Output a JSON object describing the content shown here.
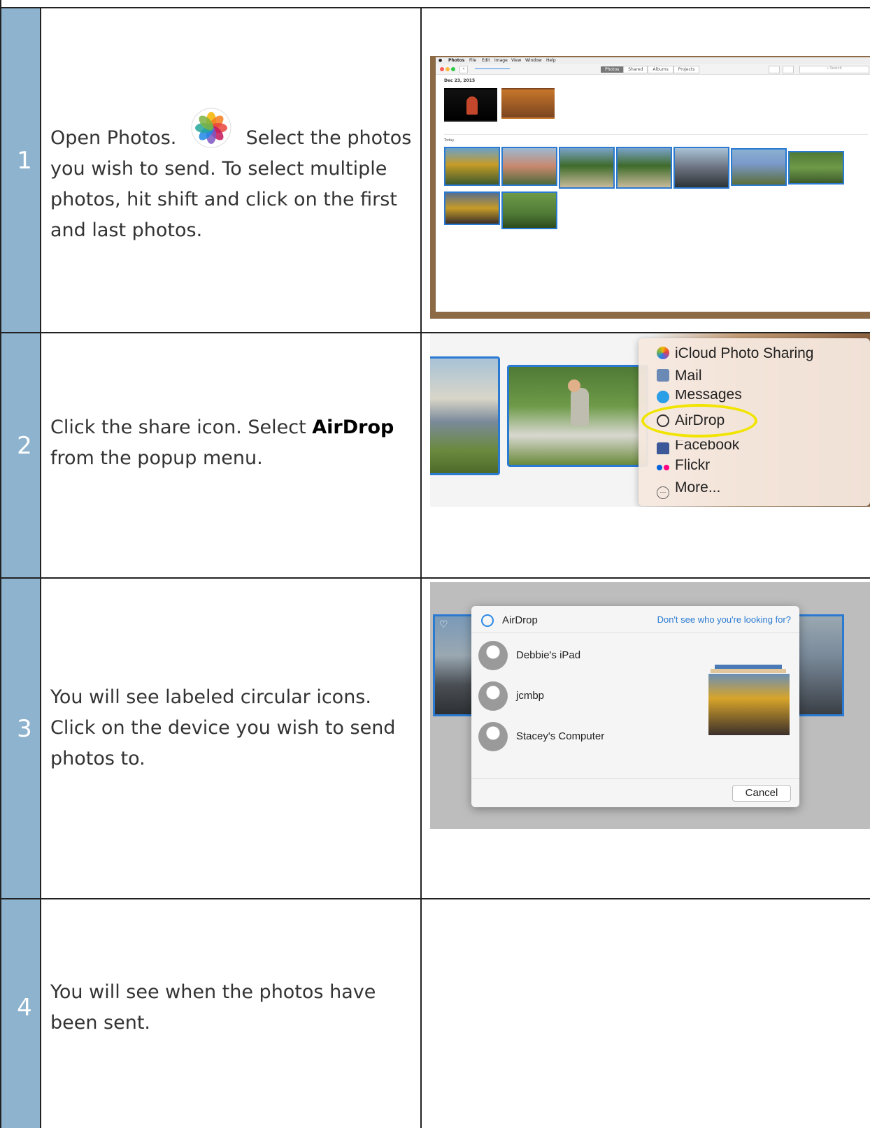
{
  "steps": [
    {
      "number": "1",
      "text_before": "Open Photos.",
      "text_after": "Select the photos you wish to send.  To select multiple photos, hit shift and click on the first and last photos."
    },
    {
      "number": "2",
      "text_before": "Click the share icon.  Select ",
      "highlight": "AirDrop",
      "text_after": " from the popup menu."
    },
    {
      "number": "3",
      "text": "You will see labeled circular icons.  Click on the device you wish to send photos to."
    },
    {
      "number": "4",
      "text": "You will see when the photos have been sent."
    }
  ],
  "photos_app": {
    "menu": [
      "Photos",
      "File",
      "Edit",
      "Image",
      "View",
      "Window",
      "Help"
    ],
    "tabs": [
      "Photos",
      "Shared",
      "Albums",
      "Projects"
    ],
    "search_placeholder": "Search",
    "date_group": "Dec 23, 2015",
    "today_group": "Today"
  },
  "share_menu": {
    "items": [
      {
        "label": "iCloud Photo Sharing",
        "icon": "icloud-photos-icon"
      },
      {
        "label": "Mail",
        "icon": "mail-icon"
      },
      {
        "label": "Messages",
        "icon": "messages-icon"
      },
      {
        "label": "AirDrop",
        "icon": "airdrop-icon"
      },
      {
        "label": "Facebook",
        "icon": "facebook-icon"
      },
      {
        "label": "Flickr",
        "icon": "flickr-icon"
      },
      {
        "label": "More...",
        "icon": "more-icon"
      }
    ],
    "highlight_color": "#f0e400"
  },
  "airdrop_dialog": {
    "title": "AirDrop",
    "help_link": "Don't see who you're looking for?",
    "devices": [
      "Debbie's iPad",
      "jcmbp",
      "Stacey's Computer"
    ],
    "cancel_label": "Cancel"
  },
  "colors": {
    "step_column": "#8db3cf",
    "selection_blue": "#2a7ad2"
  }
}
